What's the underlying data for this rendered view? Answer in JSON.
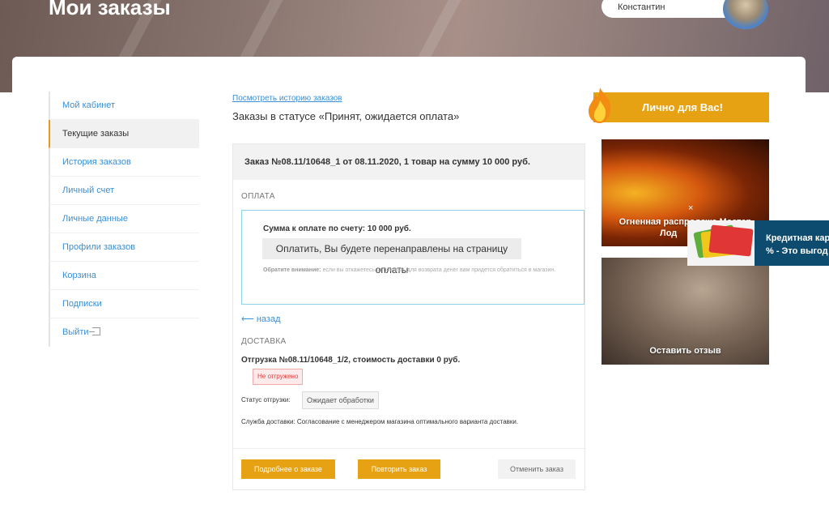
{
  "header": {
    "title": "Мои заказы",
    "user_name": "Константин"
  },
  "sidebar": {
    "items": [
      {
        "label": "Мой кабинет"
      },
      {
        "label": "Текущие заказы"
      },
      {
        "label": "История заказов"
      },
      {
        "label": "Личный счет"
      },
      {
        "label": "Личные данные"
      },
      {
        "label": "Профили заказов"
      },
      {
        "label": "Корзина"
      },
      {
        "label": "Подписки"
      },
      {
        "label": "Выйти"
      }
    ]
  },
  "main": {
    "history_link": "Посмотреть историю заказов",
    "status_title": "Заказы в статусе «Принят, ожидается оплата»",
    "order": {
      "heading": "Заказ №08.11/10648_1 от 08.11.2020, 1 товар на сумму 10 000 руб.",
      "payment_label": "ОПЛАТА",
      "payment_sum": "Сумма к оплате по счету: 10 000 руб.",
      "pay_button": "Оплатить, Вы будете перенаправлены на страницу оплаты",
      "note_bold": "Обратите внимание:",
      "note_text": " если вы откажетесь от покупки, для возврата денег вам придется обратиться в магазин.",
      "back_link": "назад",
      "delivery_label": "ДОСТАВКА",
      "shipment_title": "Отгрузка №08.11/10648_1/2, стоимость доставки 0 руб.",
      "shipment_badge": "Не отгружено",
      "shipment_status_label": "Статус отгрузки:",
      "shipment_status_value": "Ожидает обработки",
      "delivery_service": "Служба доставки: Согласование с менеджером магазина оптимального варианта доставки.",
      "buttons": {
        "details": "Подробнее о заказе",
        "repeat": "Повторить заказ",
        "cancel": "Отменить заказ"
      }
    }
  },
  "right": {
    "promo_label": "Лично для Вас!",
    "tile1_line1": "Огненная распродажа Мастер",
    "tile1_line2": "Лод",
    "tile2_label": "Оставить отзыв",
    "close_glyph": "×",
    "popup_line1": "Кредитная кар",
    "popup_line2": "% - Это выгод"
  },
  "colors": {
    "accent": "#e6a213",
    "link": "#3a8fd6",
    "payment_border": "#8fd3e6",
    "error": "#e34040",
    "popup_bg": "#0d4c6e"
  }
}
